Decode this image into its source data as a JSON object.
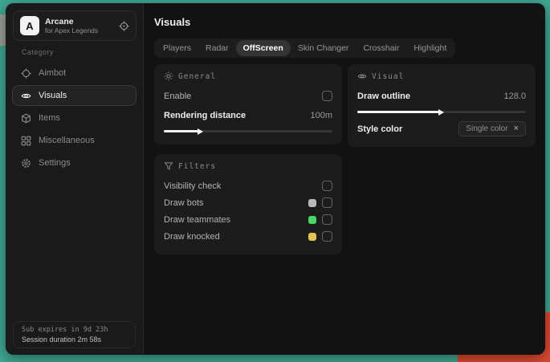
{
  "desktop": {
    "teal": "#3fa893",
    "gray_patch": "#99a099",
    "red_patch": "#df4a31"
  },
  "brand": {
    "initial": "A",
    "name": "Arcane",
    "subtitle": "for Apex Legends"
  },
  "sidebar": {
    "category_label": "Category",
    "items": [
      {
        "label": "Aimbot"
      },
      {
        "label": "Visuals"
      },
      {
        "label": "Items"
      },
      {
        "label": "Miscellaneous"
      },
      {
        "label": "Settings"
      }
    ],
    "footer": {
      "line1": "Sub expires in 9d 23h",
      "line2": "Session duration 2m 58s"
    }
  },
  "header": {
    "title": "Visuals"
  },
  "tabs": [
    {
      "label": "Players"
    },
    {
      "label": "Radar"
    },
    {
      "label": "OffScreen"
    },
    {
      "label": "Skin Changer"
    },
    {
      "label": "Crosshair"
    },
    {
      "label": "Highlight"
    }
  ],
  "panels": {
    "general": {
      "title": "General",
      "enable_label": "Enable",
      "rendering_label": "Rendering distance",
      "rendering_value": "100m",
      "rendering_fill": "22%"
    },
    "visual": {
      "title": "Visual",
      "outline_label": "Draw outline",
      "outline_value": "128.0",
      "outline_fill": "50%",
      "style_label": "Style color",
      "style_value": "Single color",
      "style_remove": "×"
    },
    "filters": {
      "title": "Filters",
      "rows": [
        {
          "label": "Visibility check",
          "checked": false
        },
        {
          "label": "Draw bots",
          "swatch": "#b8b8b8",
          "checked": false
        },
        {
          "label": "Draw teammates",
          "swatch": "#47d764",
          "checked": false
        },
        {
          "label": "Draw knocked",
          "swatch": "#e2c452",
          "checked": false
        }
      ]
    }
  }
}
